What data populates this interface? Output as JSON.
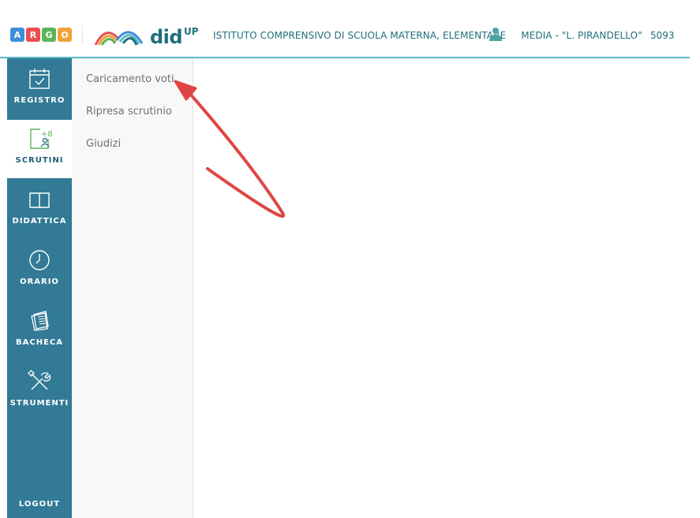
{
  "header": {
    "argo_letters": [
      "A",
      "R",
      "G",
      "O"
    ],
    "argo_colors": [
      "#3d8ed8",
      "#e84f4f",
      "#5db35a",
      "#f0a23a"
    ],
    "didup_text": "did",
    "didup_sup": "UP",
    "school_title_part1": "ISTITUTO COMPRENSIVO DI SCUOLA MATERNA, ELEMENTARE",
    "school_title_part2": "MEDIA - \"L. PIRANDELLO\"",
    "school_code": "5093"
  },
  "sidebar": {
    "items": [
      {
        "label": "REGISTRO",
        "icon": "calendar-check-icon"
      },
      {
        "label": "SCRUTINI",
        "icon": "grade-add-icon"
      },
      {
        "label": "DIDATTICA",
        "icon": "open-book-icon"
      },
      {
        "label": "ORARIO",
        "icon": "clock-icon"
      },
      {
        "label": "BACHECA",
        "icon": "noticeboard-icon"
      },
      {
        "label": "STRUMENTI",
        "icon": "tools-icon"
      }
    ],
    "active": "SCRUTINI",
    "logout": "LOGOUT"
  },
  "submenu": {
    "items": [
      {
        "label": "Caricamento voti"
      },
      {
        "label": "Ripresa scrutinio"
      },
      {
        "label": "Giudizi"
      }
    ]
  },
  "colors": {
    "sidebar_bg": "#327a95",
    "accent": "#1f6e7d",
    "arrow": "#e04545"
  }
}
